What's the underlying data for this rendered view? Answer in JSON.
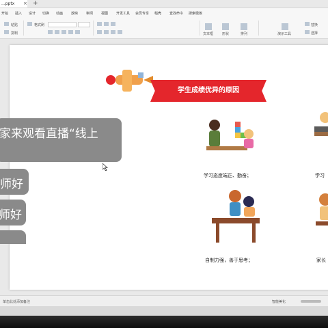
{
  "titlebar": {
    "tab_label": "...pptx",
    "close": "×",
    "new_tab": "+"
  },
  "menu": {
    "items": [
      "开始",
      "插入",
      "设计",
      "切换",
      "动画",
      "放映",
      "审阅",
      "视图",
      "开发工具",
      "会员专享",
      "稻壳",
      "查找命令",
      "搜索模板"
    ]
  },
  "ribbon": {
    "groups": [
      "粘贴",
      "复制",
      "格式刷",
      "文本框",
      "形状",
      "排列",
      "演示工具",
      "替换",
      "选择"
    ]
  },
  "slide": {
    "banner_title": "学生成绩优异的原因",
    "captions": [
      "学习态度端正、勤奋；",
      "学习",
      "自制力强，善于思考；",
      "家长"
    ]
  },
  "status": {
    "left": "单击此处添加备注",
    "right": "智能美化"
  },
  "chat": {
    "messages": [
      "欢迎大家来观看直播“线上",
      "老师好",
      "老师好",
      ""
    ]
  }
}
